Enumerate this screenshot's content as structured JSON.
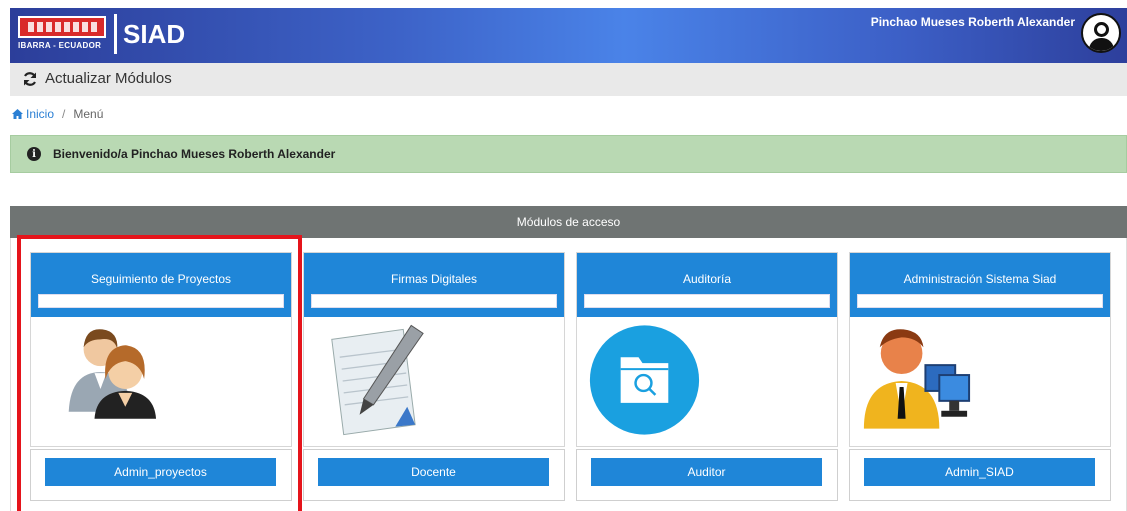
{
  "header": {
    "logo_sub": "IBARRA - ECUADOR",
    "app_name": "SIAD",
    "user_name": "Pinchao Mueses Roberth Alexander"
  },
  "toolbar": {
    "refresh_label": "Actualizar Módulos"
  },
  "breadcrumb": {
    "home": "Inicio",
    "current": "Menú"
  },
  "alert": {
    "text": "Bienvenido/a Pinchao Mueses Roberth Alexander"
  },
  "modules": {
    "title": "Módulos de acceso",
    "cards": [
      {
        "title": "Seguimiento de Proyectos",
        "icon": "users-icon",
        "role": "Admin_proyectos"
      },
      {
        "title": "Firmas Digitales",
        "icon": "pen-document-icon",
        "role": "Docente"
      },
      {
        "title": "Auditoría",
        "icon": "folder-search-icon",
        "role": "Auditor"
      },
      {
        "title": "Administración Sistema Siad",
        "icon": "admin-computer-icon",
        "role": "Admin_SIAD"
      }
    ]
  },
  "colors": {
    "header_blue": "#3d63c8",
    "card_blue": "#1f86d8",
    "alert_green": "#b9d9b3",
    "panel_gray": "#6f7473",
    "highlight_red": "#e5141b"
  }
}
